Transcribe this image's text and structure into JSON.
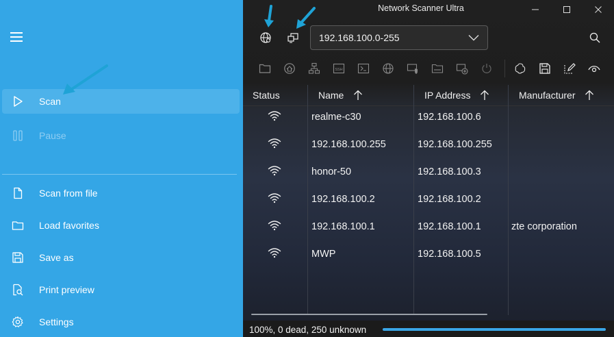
{
  "window": {
    "title": "Network Scanner Ultra"
  },
  "sidebar": {
    "items": [
      {
        "label": "Scan",
        "icon": "play-icon",
        "state": "active"
      },
      {
        "label": "Pause",
        "icon": "pause-icon",
        "state": "disabled"
      },
      {
        "label": "Scan from file",
        "icon": "file-icon",
        "state": "normal"
      },
      {
        "label": "Load favorites",
        "icon": "folder-icon",
        "state": "normal"
      },
      {
        "label": "Save as",
        "icon": "save-icon",
        "state": "normal"
      },
      {
        "label": "Print preview",
        "icon": "print-preview-icon",
        "state": "normal"
      },
      {
        "label": "Settings",
        "icon": "gear-icon",
        "state": "normal"
      }
    ]
  },
  "range": {
    "value": "192.168.100.0-255"
  },
  "table": {
    "columns": [
      "Status",
      "Name",
      "IP Address",
      "Manufacturer"
    ],
    "rows": [
      {
        "name": "realme-c30",
        "ip": "192.168.100.6",
        "manufacturer": ""
      },
      {
        "name": "192.168.100.255",
        "ip": "192.168.100.255",
        "manufacturer": ""
      },
      {
        "name": "honor-50",
        "ip": "192.168.100.3",
        "manufacturer": ""
      },
      {
        "name": "192.168.100.2",
        "ip": "192.168.100.2",
        "manufacturer": ""
      },
      {
        "name": "192.168.100.1",
        "ip": "192.168.100.1",
        "manufacturer": "zte corporation"
      },
      {
        "name": "MWP",
        "ip": "192.168.100.5",
        "manufacturer": ""
      }
    ]
  },
  "status": {
    "text": "100%, 0 dead, 250 unknown",
    "progress_percent": 100
  },
  "colors": {
    "sidebar": "#34a6e6",
    "accent": "#3aa6e6",
    "annotation_arrow": "#1fa3d6"
  }
}
